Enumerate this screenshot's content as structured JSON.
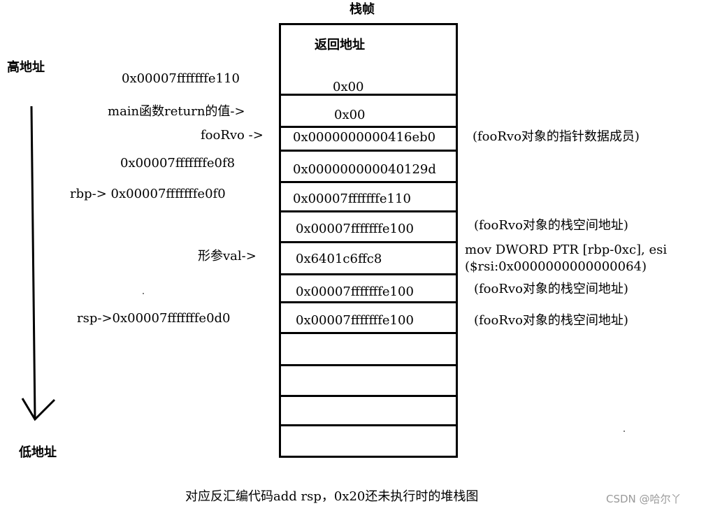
{
  "title": "栈帧",
  "high_address_label": "高地址",
  "low_address_label": "低地址",
  "caption": "对应反汇编代码add rsp，0x20还未执行时的堆栈图",
  "watermark": "CSDN @哈尔丫",
  "stack_cells": [
    "返回地址",
    "0x00",
    "0x00",
    "0x0000000000416eb0",
    "0x000000000040129d",
    "0x00007fffffffe110",
    "0x00007fffffffe100",
    "0x6401c6ffc8",
    "0x00007fffffffe100",
    "0x00007fffffffe100",
    "",
    "",
    "",
    ""
  ],
  "left_labels": [
    "0x00007fffffffe110",
    "main函数return的值->",
    "fooRvo ->",
    "0x00007fffffffe0f8",
    "rbp-> 0x00007fffffffe0f0",
    "形参val->",
    "rsp->0x00007fffffffe0d0"
  ],
  "right_notes": [
    "(fooRvo对象的指针数据成员)",
    "(fooRvo对象的栈空间地址)",
    "mov DWORD PTR [rbp-0xc], esi",
    "($rsi:0x0000000000000064)",
    "(fooRvo对象的栈空间地址)",
    "(fooRvo对象的栈空间地址)"
  ]
}
